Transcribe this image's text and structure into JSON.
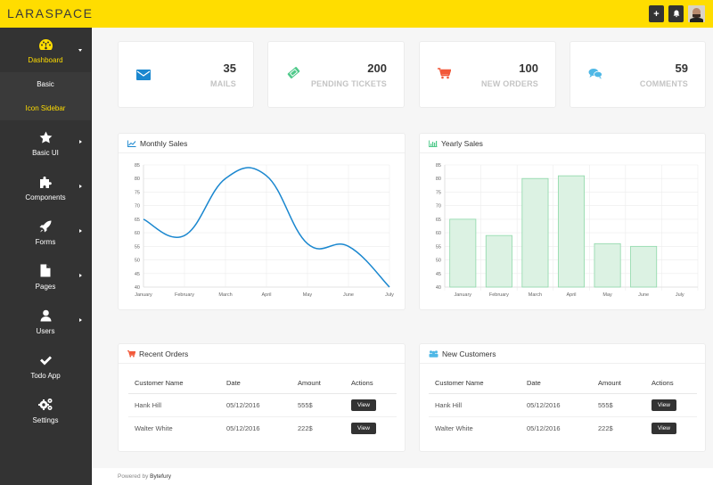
{
  "app": {
    "brand": "LARASPACE",
    "top_actions": [
      {
        "name": "add-button",
        "icon": "plus-icon",
        "glyph": "+"
      },
      {
        "name": "notifications-button",
        "icon": "bell-icon",
        "glyph": "🔔"
      }
    ]
  },
  "sidebar": {
    "items": [
      {
        "label": "Dashboard",
        "icon": "dashboard-icon",
        "active": true,
        "expanded": true,
        "children": [
          {
            "label": "Basic",
            "active": false
          },
          {
            "label": "Icon Sidebar",
            "active": true
          }
        ]
      },
      {
        "label": "Basic UI",
        "icon": "star-icon",
        "has_children": true
      },
      {
        "label": "Components",
        "icon": "puzzle-icon",
        "has_children": true
      },
      {
        "label": "Forms",
        "icon": "rocket-icon",
        "has_children": true
      },
      {
        "label": "Pages",
        "icon": "file-icon",
        "has_children": true
      },
      {
        "label": "Users",
        "icon": "user-icon",
        "has_children": true
      },
      {
        "label": "Todo App",
        "icon": "check-icon",
        "has_children": false
      },
      {
        "label": "Settings",
        "icon": "cogs-icon",
        "has_children": false
      }
    ]
  },
  "stats": [
    {
      "value": "35",
      "label": "MAILS",
      "icon": "envelope-icon",
      "color": "#1a87cf"
    },
    {
      "value": "200",
      "label": "PENDING TICKETS",
      "icon": "ticket-icon",
      "color": "#4fc98a"
    },
    {
      "value": "100",
      "label": "NEW ORDERS",
      "icon": "cart-icon",
      "color": "#f2593a"
    },
    {
      "value": "59",
      "label": "COMMENTS",
      "icon": "comments-icon",
      "color": "#4fb8e6"
    }
  ],
  "panels": {
    "monthly_sales": {
      "title": "Monthly Sales",
      "icon": "line-chart-icon"
    },
    "yearly_sales": {
      "title": "Yearly Sales",
      "icon": "bar-chart-icon"
    },
    "recent_orders": {
      "title": "Recent Orders",
      "icon": "cart-icon"
    },
    "new_customers": {
      "title": "New Customers",
      "icon": "users-icon"
    }
  },
  "chart_data": [
    {
      "type": "line",
      "title": "Monthly Sales",
      "categories": [
        "January",
        "February",
        "March",
        "April",
        "May",
        "June",
        "July"
      ],
      "values": [
        65,
        59,
        80,
        81,
        56,
        55,
        40
      ],
      "ylim": [
        40,
        85
      ],
      "yticks": [
        40,
        45,
        50,
        55,
        60,
        65,
        70,
        75,
        80,
        85
      ],
      "xlabel": "",
      "ylabel": "",
      "grid": true,
      "color": "#1a87cf"
    },
    {
      "type": "bar",
      "title": "Yearly Sales",
      "categories": [
        "January",
        "February",
        "March",
        "April",
        "May",
        "June",
        "July"
      ],
      "values": [
        65,
        59,
        80,
        81,
        56,
        55,
        40
      ],
      "ylim": [
        40,
        85
      ],
      "yticks": [
        40,
        45,
        50,
        55,
        60,
        65,
        70,
        75,
        80,
        85
      ],
      "xlabel": "",
      "ylabel": "",
      "grid": true,
      "fill": "#dcf2e3",
      "stroke": "#8dd8a8"
    }
  ],
  "tables": {
    "columns": [
      "Customer Name",
      "Date",
      "Amount",
      "Actions"
    ],
    "recent_orders": [
      {
        "name": "Hank Hill",
        "date": "05/12/2016",
        "amount": "555$",
        "action": "View"
      },
      {
        "name": "Walter White",
        "date": "05/12/2016",
        "amount": "222$",
        "action": "View"
      }
    ],
    "new_customers": [
      {
        "name": "Hank Hill",
        "date": "05/12/2016",
        "amount": "555$",
        "action": "View"
      },
      {
        "name": "Walter White",
        "date": "05/12/2016",
        "amount": "222$",
        "action": "View"
      }
    ]
  },
  "footer": {
    "prefix": "Powered by",
    "brand": "Bytefury"
  }
}
